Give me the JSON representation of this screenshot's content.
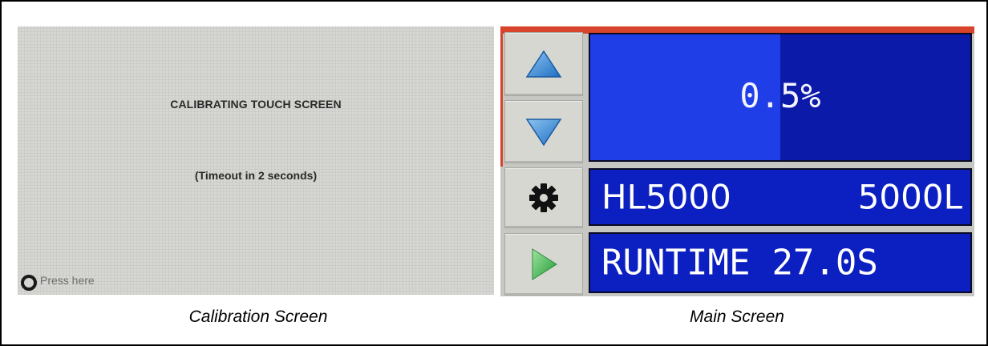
{
  "calibration_screen": {
    "title": "CALIBRATING TOUCH SCREEN",
    "timeout_text": "(Timeout in  2 seconds)",
    "press_label": "Press here",
    "press_icon": "ring-target-icon"
  },
  "main_screen": {
    "value_display": "0.5%",
    "value_fill_fraction": 0.5,
    "model": "HL5000",
    "capacity": "5000L",
    "runtime_label": "RUNTIME",
    "runtime_value": "27.0S",
    "buttons": {
      "up_icon": "up-triangle-icon",
      "down_icon": "down-triangle-icon",
      "settings_icon": "gear-icon",
      "play_icon": "play-icon"
    },
    "colors": {
      "panel_blue": "#0c1fc0",
      "value_fill_blue": "#1f3ee8",
      "top_accent_red": "#d8442b",
      "arrow_blue": "#2f86d6",
      "play_green": "#3dbb4a"
    }
  },
  "captions": {
    "left": "Calibration Screen",
    "right": "Main Screen"
  }
}
